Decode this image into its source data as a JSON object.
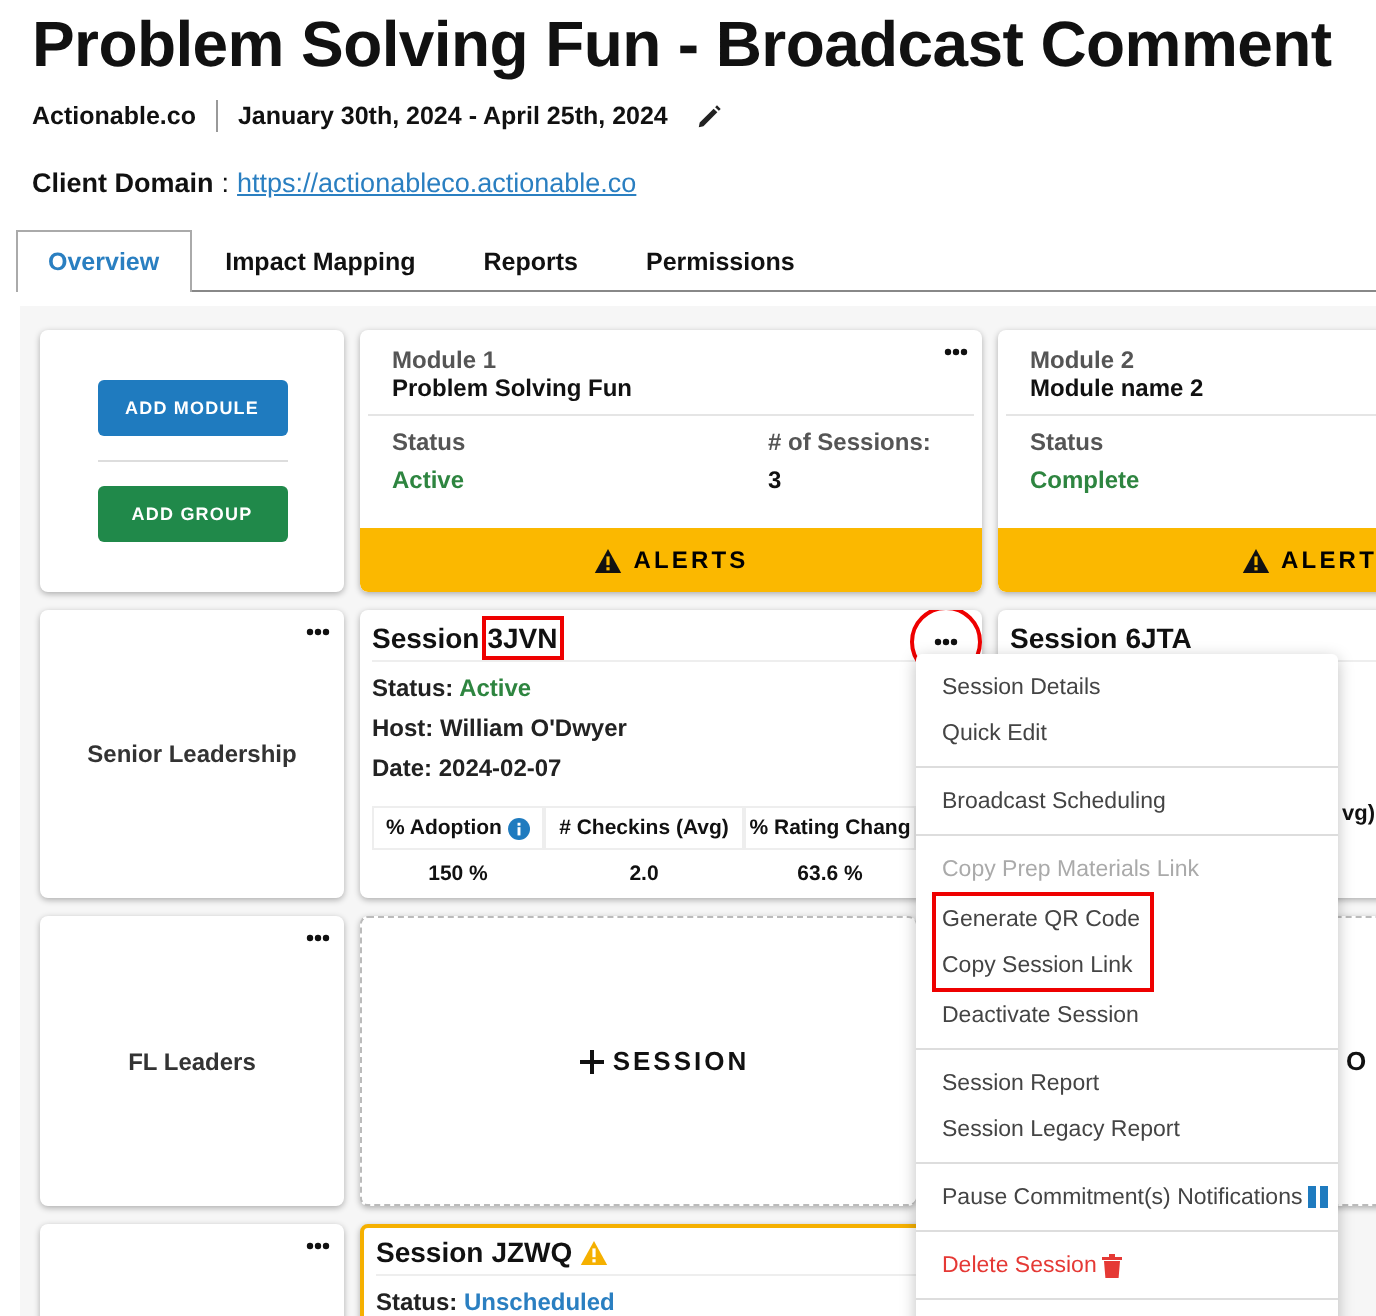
{
  "title": "Problem Solving Fun - Broadcast Comment",
  "client": "Actionable.co",
  "date_range": "January 30th, 2024 - April 25th, 2024",
  "client_domain": {
    "label": "Client Domain",
    "separator": ":",
    "url": "https://actionableco.actionable.co"
  },
  "tabs": [
    {
      "label": "Overview",
      "selected": true
    },
    {
      "label": "Impact Mapping",
      "selected": false
    },
    {
      "label": "Reports",
      "selected": false
    },
    {
      "label": "Permissions",
      "selected": false
    }
  ],
  "actions": [
    {
      "label": "ADD MODULE",
      "kind": "module"
    },
    {
      "label": "ADD GROUP",
      "kind": "group"
    }
  ],
  "modules": [
    {
      "label": "Module 1",
      "name": "Problem Solving Fun",
      "status_label": "Status",
      "status": "Active",
      "color": "#2e8540",
      "sessions_label": "# of Sessions:",
      "sessions": "3",
      "alerts": "ALERTS"
    },
    {
      "label": "Module 2",
      "name": "Module name 2",
      "status_label": "Status",
      "status": "Complete",
      "color": "#2e8540",
      "alerts": "ALERT"
    }
  ],
  "groups": [
    {
      "name": "Senior Leadership",
      "sessions": [
        {
          "kind": "session",
          "prefix": "Session",
          "code": "3JVN",
          "code_highlighted": true,
          "menu_circled": true,
          "warning": false,
          "status_label": "Status:",
          "status": "Active",
          "color": "#2e8540",
          "host": "Host: William O'Dwyer",
          "date": "Date: 2024-02-07",
          "stats": [
            {
              "header": "% Adoption",
              "info": true,
              "value": "150 %"
            },
            {
              "header": "# Checkins (Avg)",
              "info": false,
              "value": "2.0"
            },
            {
              "header": "% Rating Chang",
              "info": false,
              "value": "63.6 %"
            }
          ]
        },
        {
          "kind": "session",
          "prefix": "Session",
          "code": "6JTA",
          "code_highlighted": false,
          "warning": false,
          "stats": [
            {
              "header": "vg)"
            }
          ]
        }
      ]
    },
    {
      "name": "FL Leaders",
      "sessions": [
        {
          "kind": "add",
          "label": "SESSION"
        },
        {
          "kind": "add_cut",
          "label": "O"
        }
      ]
    },
    {
      "sessions": [
        {
          "kind": "session",
          "prefix": "Session",
          "code": "JZWQ",
          "code_highlighted": false,
          "warning": true,
          "status_label": "Status:",
          "status": "Unscheduled",
          "color": "#2a7fc1"
        }
      ]
    }
  ],
  "menu": [
    [
      {
        "label": "Session Details",
        "kind": "item",
        "disabled": false,
        "highlighted": false
      },
      {
        "label": "Quick Edit",
        "kind": "item",
        "disabled": false,
        "highlighted": false
      }
    ],
    [
      {
        "label": "Broadcast Scheduling",
        "kind": "item",
        "disabled": false,
        "highlighted": false
      }
    ],
    [
      {
        "label": "Copy Prep Materials Link",
        "kind": "item",
        "disabled": true,
        "highlighted": false
      },
      {
        "label": "Generate QR Code",
        "kind": "item",
        "disabled": false,
        "highlighted": true
      },
      {
        "label": "Copy Session Link",
        "kind": "item",
        "disabled": false,
        "highlighted": true
      },
      {
        "label": "Deactivate Session",
        "kind": "item",
        "disabled": false,
        "highlighted": false
      }
    ],
    [
      {
        "label": "Session Report",
        "kind": "item",
        "disabled": false,
        "highlighted": false
      },
      {
        "label": "Session Legacy Report",
        "kind": "item",
        "disabled": false,
        "highlighted": false
      }
    ],
    [
      {
        "label": "Pause Commitment(s) Notifications",
        "kind": "pause",
        "disabled": false,
        "highlighted": false
      }
    ],
    [
      {
        "label": "Delete Session",
        "kind": "delete",
        "disabled": false,
        "highlighted": false
      }
    ]
  ]
}
